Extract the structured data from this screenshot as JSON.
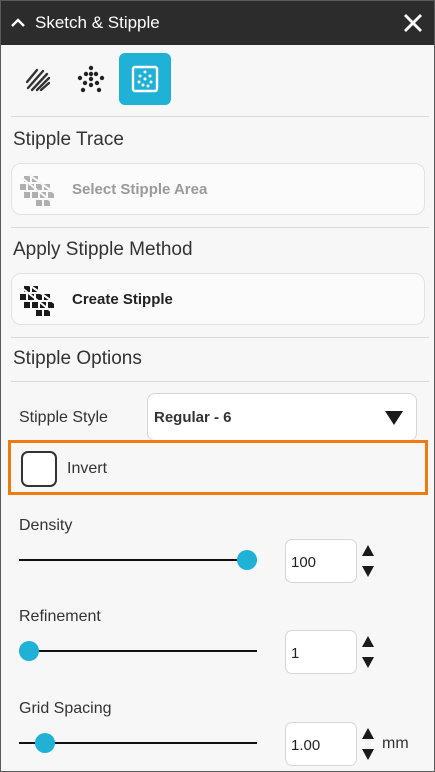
{
  "window": {
    "title": "Sketch & Stipple"
  },
  "icons": {
    "collapse": "chevron-up-icon",
    "close": "close-icon",
    "modes": [
      "sketch-strokes-icon",
      "stipple-dots-icon",
      "stipple-pattern-icon"
    ]
  },
  "colors": {
    "accent": "#1fb1d6",
    "highlight": "#ee7a10",
    "titlebar": "#2c2c2c"
  },
  "stipple_trace": {
    "title": "Stipple Trace",
    "button_label": "Select Stipple Area"
  },
  "apply_method": {
    "title": "Apply Stipple Method",
    "button_label": "Create Stipple"
  },
  "options": {
    "title": "Stipple Options",
    "style_label": "Stipple Style",
    "style_value": "Regular - 6",
    "invert_label": "Invert",
    "invert_checked": false,
    "density": {
      "label": "Density",
      "value": "100",
      "level": 1.0
    },
    "refinement": {
      "label": "Refinement",
      "value": "1",
      "level": 0.0
    },
    "grid_spacing": {
      "label": "Grid Spacing",
      "value": "1.00",
      "unit": "mm",
      "level": 0.05
    }
  }
}
